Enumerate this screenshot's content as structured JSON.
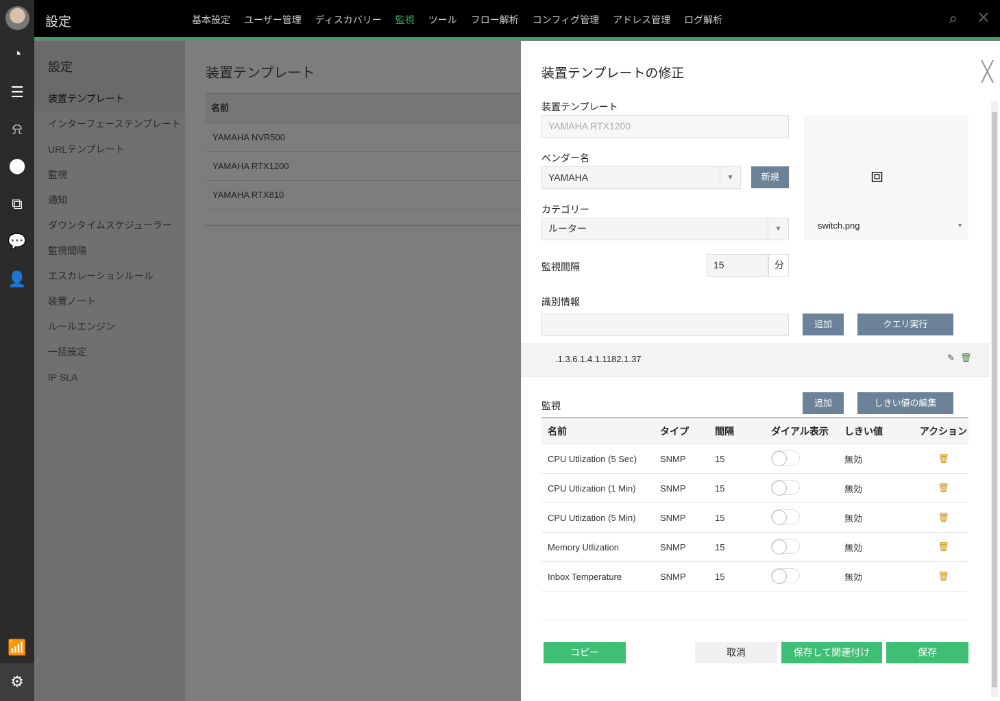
{
  "header": {
    "title": "設定",
    "nav": [
      "基本設定",
      "ユーザー管理",
      "ディスカバリー",
      "監視",
      "ツール",
      "フロー解析",
      "コンフィグ管理",
      "アドレス管理",
      "ログ解析"
    ],
    "active_nav": "監視"
  },
  "sidebar": {
    "title": "設定",
    "items": [
      "装置テンプレート",
      "インターフェーステンプレート",
      "URLテンプレート",
      "監視",
      "通知",
      "ダウンタイムスケジューラー",
      "監視間隔",
      "エスカレーションルール",
      "装置ノート",
      "ルールエンジン",
      "一括設定",
      "IP SLA"
    ]
  },
  "main": {
    "title": "装置テンプレート",
    "col_name": "名前",
    "rows": [
      "YAMAHA NVR500",
      "YAMAHA RTX1200",
      "YAMAHA RTX810"
    ]
  },
  "panel": {
    "title": "装置テンプレートの修正",
    "template_label": "装置テンプレート",
    "template_value": "YAMAHA RTX1200",
    "vendor_label": "ベンダー名",
    "vendor_value": "YAMAHA",
    "new_button": "新規",
    "category_label": "カテゴリー",
    "category_value": "ルーター",
    "interval_label": "監視間隔",
    "interval_value": "15",
    "interval_unit": "分",
    "image_name": "switch.png",
    "ident_label": "識別情報",
    "ident_add": "追加",
    "query_button": "クエリ実行",
    "oid": ".1.3.6.1.4.1.1182.1.37",
    "monitor_label": "監視",
    "monitor_add": "追加",
    "threshold_edit": "しきい値の編集",
    "columns": [
      "名前",
      "タイプ",
      "間隔",
      "ダイアル表示",
      "しきい値",
      "アクション"
    ],
    "monitors": [
      {
        "name": "CPU Utlization (5 Sec)",
        "type": "SNMP",
        "interval": "15",
        "threshold": "無効",
        "dial": false
      },
      {
        "name": "CPU Utlization (1 Min)",
        "type": "SNMP",
        "interval": "15",
        "threshold": "無効",
        "dial": false
      },
      {
        "name": "CPU Utlization (5 Min)",
        "type": "SNMP",
        "interval": "15",
        "threshold": "無効",
        "dial": false
      },
      {
        "name": "Memory Utlization",
        "type": "SNMP",
        "interval": "15",
        "threshold": "無効",
        "dial": false
      },
      {
        "name": "Inbox Temperature",
        "type": "SNMP",
        "interval": "15",
        "threshold": "無効",
        "dial": false
      }
    ],
    "copy": "コピー",
    "cancel": "取消",
    "save_associate": "保存して関連付け",
    "save": "保存"
  }
}
